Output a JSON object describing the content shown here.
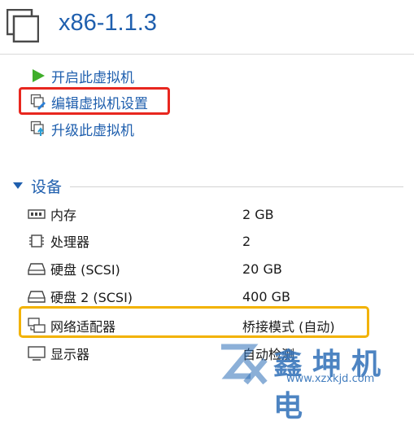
{
  "vm": {
    "title": "x86-1.1.3",
    "icon": "vm-icon"
  },
  "actions": [
    {
      "label": "开启此虚拟机",
      "icon": "play-icon"
    },
    {
      "label": "编辑虚拟机设置",
      "icon": "edit-settings-icon"
    },
    {
      "label": "升级此虚拟机",
      "icon": "upgrade-icon"
    }
  ],
  "devices": {
    "section_label": "设备",
    "items": [
      {
        "name": "内存",
        "value": "2 GB",
        "icon": "memory-icon"
      },
      {
        "name": "处理器",
        "value": "2",
        "icon": "cpu-icon"
      },
      {
        "name": "硬盘 (SCSI)",
        "value": "20 GB",
        "icon": "disk-icon"
      },
      {
        "name": "硬盘 2 (SCSI)",
        "value": "400 GB",
        "icon": "disk-icon"
      },
      {
        "name": "网络适配器",
        "value": "桥接模式 (自动)",
        "icon": "network-adapter-icon"
      },
      {
        "name": "显示器",
        "value": "自动检测",
        "icon": "monitor-icon"
      }
    ]
  },
  "highlight_colors": {
    "red": "#e8271f",
    "yellow": "#f2b200"
  },
  "accent_color": "#1f5fae",
  "watermark": {
    "text": "鑫坤机电",
    "url": "www.xzxkjd.com"
  }
}
